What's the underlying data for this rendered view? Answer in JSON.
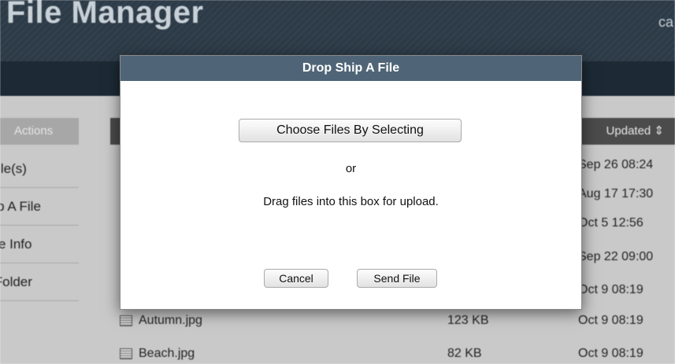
{
  "header": {
    "title": "File Manager",
    "right_text": "ca"
  },
  "sidebar": {
    "heading": "Actions",
    "items": [
      {
        "label": "New File(s)"
      },
      {
        "label": "Drop Ship A File"
      },
      {
        "label": "File Info"
      },
      {
        "label": "New Folder"
      }
    ]
  },
  "table": {
    "updated_header": "Updated ⇕",
    "dates_behind_modal": [
      "Sep 26 08:24",
      "Aug 17 17:30",
      "Oct 5 12:56",
      "Sep 22 09:00",
      "Oct 9 08:19"
    ],
    "rows": [
      {
        "name": "Autumn.jpg",
        "size": "123 KB",
        "updated": "Oct 9 08:19"
      },
      {
        "name": "Beach.jpg",
        "size": "82 KB",
        "updated": "Oct 9 08:19"
      }
    ]
  },
  "modal": {
    "title": "Drop Ship A File",
    "choose_label": "Choose Files By Selecting",
    "or_text": "or",
    "drag_text": "Drag files into this box for upload.",
    "cancel_label": "Cancel",
    "send_label": "Send File"
  },
  "colors": {
    "header_bg": "#2d3b48",
    "modal_title_bg": "#4f6577",
    "table_header_bg": "#4b4b4b"
  }
}
